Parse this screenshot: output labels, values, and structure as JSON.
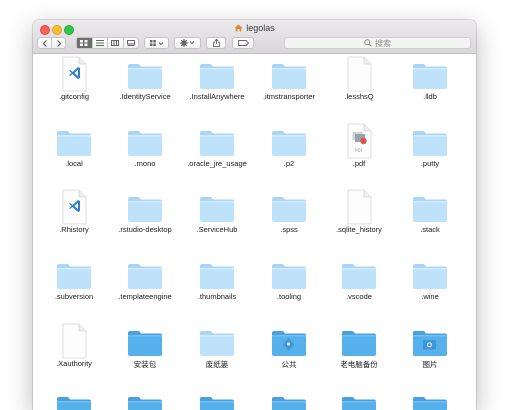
{
  "window": {
    "title": "legolas",
    "search_placeholder": "搜索"
  },
  "toolbar": {
    "back_icon": "chevron-left-icon",
    "forward_icon": "chevron-right-icon",
    "view_icons": [
      "icon-view-icon",
      "list-view-icon",
      "column-view-icon",
      "gallery-view-icon"
    ],
    "arrange_icon": "arrange-icon",
    "action_icon": "gear-icon",
    "share_icon": "share-icon",
    "tag_icon": "tag-icon"
  },
  "colors": {
    "folder_light": "#bfe2fb",
    "folder_dark": "#56b0ec",
    "selection": "#6d6d6d"
  },
  "files": [
    {
      "name": ".gitconfig",
      "kind": "vscode-doc"
    },
    {
      "name": ".IdentityService",
      "kind": "folder"
    },
    {
      "name": ".InstallAnywhere",
      "kind": "folder"
    },
    {
      "name": ".itmstransporter",
      "kind": "folder"
    },
    {
      "name": ".lesshsQ",
      "kind": "doc"
    },
    {
      "name": ".lldb",
      "kind": "folder"
    },
    {
      "name": ".local",
      "kind": "folder"
    },
    {
      "name": ".mono",
      "kind": "folder"
    },
    {
      "name": ".oracle_jre_usage",
      "kind": "folder"
    },
    {
      "name": ".p2",
      "kind": "folder"
    },
    {
      "name": ".pdf",
      "kind": "pdf-doc"
    },
    {
      "name": ".putty",
      "kind": "folder"
    },
    {
      "name": ".Rhistory",
      "kind": "vscode-doc"
    },
    {
      "name": ".rstudio-desktop",
      "kind": "folder"
    },
    {
      "name": ".ServiceHub",
      "kind": "folder"
    },
    {
      "name": ".spss",
      "kind": "folder"
    },
    {
      "name": ".sqlite_history",
      "kind": "doc"
    },
    {
      "name": ".stack",
      "kind": "folder"
    },
    {
      "name": ".subversion",
      "kind": "folder"
    },
    {
      "name": ".templateengine",
      "kind": "folder"
    },
    {
      "name": ".thumbnails",
      "kind": "folder"
    },
    {
      "name": ".tooling",
      "kind": "folder"
    },
    {
      "name": ".vscode",
      "kind": "folder"
    },
    {
      "name": ".wine",
      "kind": "folder"
    },
    {
      "name": ".Xauthority",
      "kind": "doc"
    },
    {
      "name": "安装包",
      "kind": "folder-dark"
    },
    {
      "name": "废纸篓",
      "kind": "folder"
    },
    {
      "name": "公共",
      "kind": "folder-public"
    },
    {
      "name": "老电脑备份",
      "kind": "folder-dark"
    },
    {
      "name": "图片",
      "kind": "folder-pictures"
    },
    {
      "name": "",
      "kind": "folder-dark"
    },
    {
      "name": "",
      "kind": "folder-dark"
    },
    {
      "name": "",
      "kind": "folder-dark"
    },
    {
      "name": "",
      "kind": "folder-dark"
    },
    {
      "name": "",
      "kind": "folder-dark"
    },
    {
      "name": "",
      "kind": "folder-dark"
    }
  ]
}
